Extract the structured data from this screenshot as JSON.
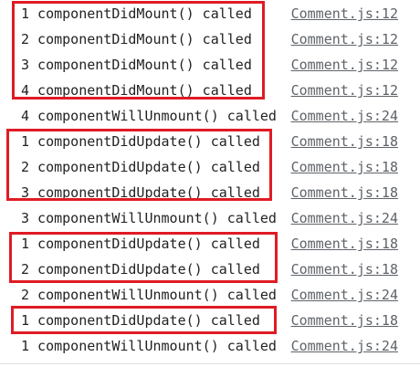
{
  "console": {
    "logs": [
      {
        "message": "1 componentDidMount() called",
        "source": "Comment.js:12"
      },
      {
        "message": "2 componentDidMount() called",
        "source": "Comment.js:12"
      },
      {
        "message": "3 componentDidMount() called",
        "source": "Comment.js:12"
      },
      {
        "message": "4 componentDidMount() called",
        "source": "Comment.js:12"
      },
      {
        "message": "4 componentWillUnmount() called",
        "source": "Comment.js:24"
      },
      {
        "message": "1 componentDidUpdate() called",
        "source": "Comment.js:18"
      },
      {
        "message": "2 componentDidUpdate() called",
        "source": "Comment.js:18"
      },
      {
        "message": "3 componentDidUpdate() called",
        "source": "Comment.js:18"
      },
      {
        "message": "3 componentWillUnmount() called",
        "source": "Comment.js:24"
      },
      {
        "message": "1 componentDidUpdate() called",
        "source": "Comment.js:18"
      },
      {
        "message": "2 componentDidUpdate() called",
        "source": "Comment.js:18"
      },
      {
        "message": "2 componentWillUnmount() called",
        "source": "Comment.js:24"
      },
      {
        "message": "1 componentDidUpdate() called",
        "source": "Comment.js:18"
      },
      {
        "message": "1 componentWillUnmount() called",
        "source": "Comment.js:24"
      }
    ]
  },
  "colors": {
    "highlight_box": "#e01b24",
    "message_text": "#222222",
    "source_link": "#5f6368"
  }
}
